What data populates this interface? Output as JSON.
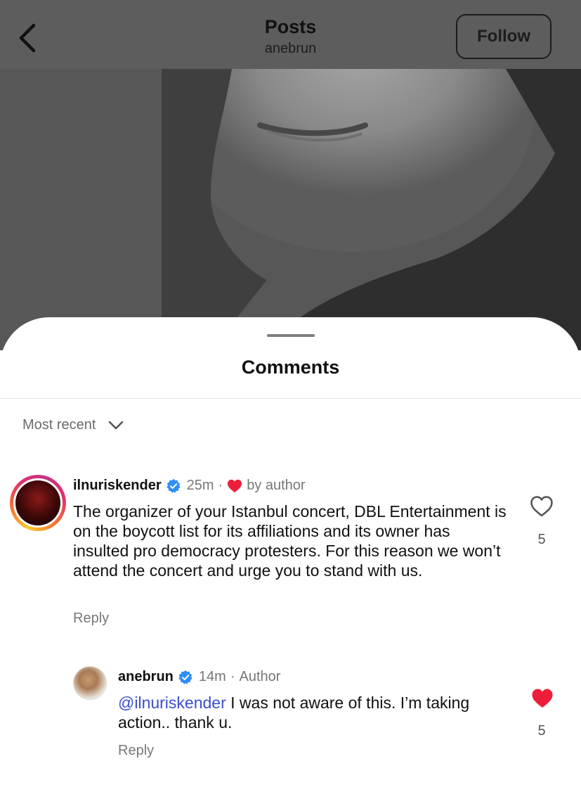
{
  "header": {
    "title": "Posts",
    "subtitle": "anebrun",
    "follow_label": "Follow"
  },
  "sheet": {
    "title": "Comments",
    "sort_label": "Most recent"
  },
  "comments": [
    {
      "username": "ilnuriskender",
      "verified": true,
      "time": "25m",
      "liked_by_author_label": "by author",
      "text": "The organizer of your Istanbul concert, DBL Entertainment is on the boycott list for its affiliations and its owner has insulted pro democracy protesters. For this reason we won’t attend the concert and urge you to stand with us.",
      "reply_label": "Reply",
      "like_count": "5",
      "liked": false
    },
    {
      "username": "anebrun",
      "verified": true,
      "time": "14m",
      "author_badge": "Author",
      "mention": "@ilnuriskender",
      "text": " I was not aware of this. I’m taking action.. thank u.",
      "reply_label": "Reply",
      "like_count": "5",
      "liked": true
    }
  ],
  "colors": {
    "verified_blue": "#2f8ef4",
    "heart_red": "#ee1d3a",
    "mention_blue": "#3a4fcf"
  }
}
